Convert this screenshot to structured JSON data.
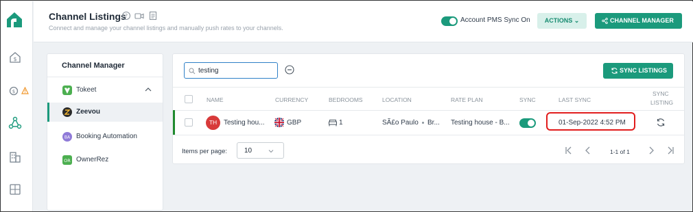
{
  "header": {
    "title": "Channel Listings",
    "subtitle": "Connect and manage your channel listings and manually push rates to your channels.",
    "pms_sync_label": "Account PMS Sync On",
    "actions_label": "ACTIONS",
    "channel_manager_label": "CHANNEL MANAGER"
  },
  "sidebar": {
    "title": "Channel Manager",
    "items": [
      {
        "label": "Tokeet",
        "badge_color": "#4caf50"
      },
      {
        "label": "Zeevou",
        "badge_color": "#2b2b2b"
      },
      {
        "label": "Booking Automation",
        "badge_color": "#8f7ad8"
      },
      {
        "label": "OwnerRez",
        "badge_color": "#4caf50"
      }
    ]
  },
  "toolbar": {
    "search_value": "testing",
    "sync_listings_label": "SYNC LISTINGS"
  },
  "table": {
    "columns": [
      "NAME",
      "CURRENCY",
      "BEDROOMS",
      "LOCATION",
      "RATE PLAN",
      "SYNC",
      "LAST SYNC",
      "SYNC",
      "LISTING"
    ],
    "rows": [
      {
        "avatar_initials": "TH",
        "name": "Testing hou...",
        "currency": "GBP",
        "bedrooms": "1",
        "location": "SÃ£o Paulo",
        "location_more": "Br...",
        "rate_plan": "Testing house - B...",
        "last_sync": "01-Sep-2022 4:52 PM"
      }
    ]
  },
  "pagination": {
    "items_per_page_label": "Items per page:",
    "items_per_page_value": "10",
    "range_label": "1-1 of 1"
  },
  "colors": {
    "accent": "#1b9a7c",
    "highlight": "#e11b1b"
  }
}
